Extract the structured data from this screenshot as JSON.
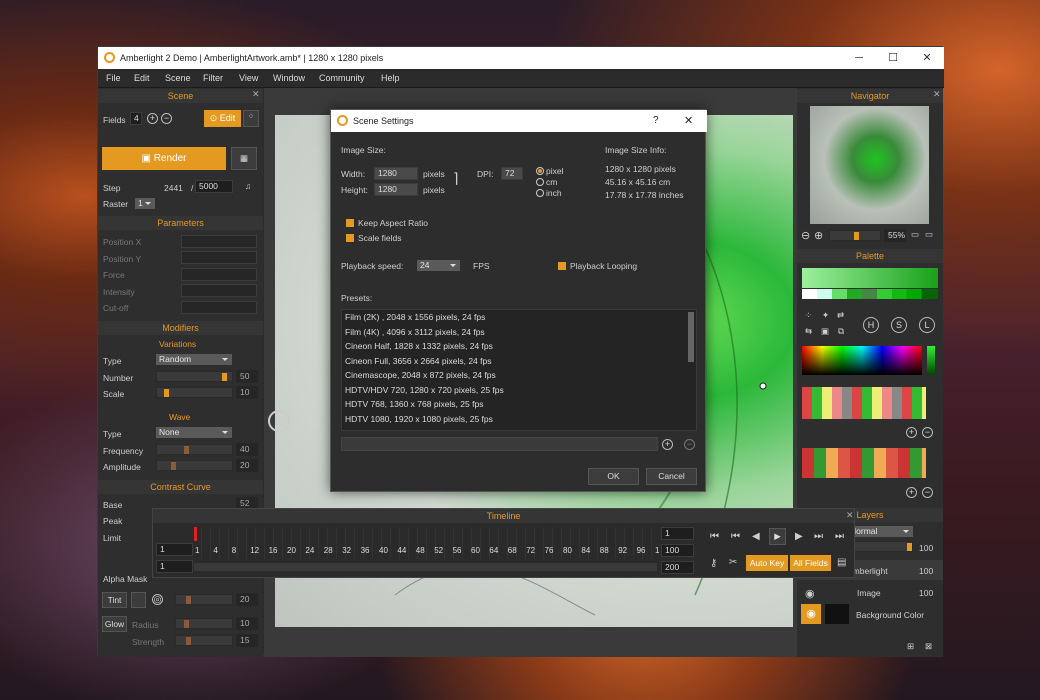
{
  "window": {
    "title": "Amberlight 2 Demo | AmberlightArtwork.amb* | 1280 x 1280 pixels"
  },
  "menu": [
    "File",
    "Edit",
    "Scene",
    "Filter",
    "View",
    "Window",
    "Community",
    "Help"
  ],
  "scene_panel": {
    "title": "Scene",
    "fields_label": "Fields",
    "fields_value": "4",
    "edit_label": "Edit",
    "render_label": "Render",
    "step_label": "Step",
    "step_value": "2441",
    "step_sep": "/",
    "step_total": "5000",
    "raster_label": "Raster",
    "raster_value": "1"
  },
  "parameters": {
    "title": "Parameters",
    "items": [
      "Position X",
      "Position Y",
      "Force",
      "Intensity",
      "Cut-off"
    ]
  },
  "modifiers": {
    "title": "Modifiers",
    "variations_title": "Variations",
    "type_label": "Type",
    "type_value": "Random",
    "number_label": "Number",
    "number_value": "50",
    "scale_label": "Scale",
    "scale_value": "10",
    "wave_title": "Wave",
    "wave_type_label": "Type",
    "wave_type_value": "None",
    "frequency_label": "Frequency",
    "frequency_value": "40",
    "amplitude_label": "Amplitude",
    "amplitude_value": "20",
    "number_level": 0.95,
    "scale_level": 0.1,
    "frequency_level": 0.4,
    "amplitude_level": 0.2
  },
  "contrast_curve": {
    "title": "Contrast Curve",
    "base_label": "Base",
    "base_value": "52",
    "peak_label": "Peak",
    "limit_label": "Limit",
    "alpha_mask_label": "Alpha Mask",
    "tint_label": "Tint",
    "tint_value": "20",
    "glow_label": "Glow",
    "radius_label": "Radius",
    "radius_value": "10",
    "strength_label": "Strength",
    "strength_value": "15"
  },
  "dialog": {
    "title": "Scene Settings",
    "help": "?",
    "close": "✕",
    "image_size_label": "Image Size:",
    "width_label": "Width:",
    "width_value": "1280",
    "height_label": "Height:",
    "height_value": "1280",
    "pixels_unit": "pixels",
    "dpi_label": "DPI:",
    "dpi_value": "72",
    "units": [
      "pixel",
      "cm",
      "inch"
    ],
    "selected_unit": "pixel",
    "info_label": "Image Size Info:",
    "info_lines": [
      "1280 x 1280 pixels",
      "45.16 x 45.16 cm",
      "17.78 x 17.78 inches"
    ],
    "keep_aspect": "Keep Aspect Ratio",
    "scale_fields": "Scale fields",
    "playback_speed_label": "Playback speed:",
    "playback_speed_value": "24",
    "fps": "FPS",
    "playback_looping": "Playback Looping",
    "presets_label": "Presets:",
    "presets": [
      "Film (2K) , 2048 x 1556 pixels, 24 fps",
      "Film (4K) , 4096 x 3112 pixels, 24 fps",
      "Cineon Half, 1828 x 1332 pixels, 24 fps",
      "Cineon Full, 3656 x 2664 pixels, 24 fps",
      "Cinemascope, 2048 x 872 pixels, 24 fps",
      "HDTV/HDV 720, 1280 x 720 pixels, 25 fps",
      "HDTV 768, 1360 x 768 pixels, 25 fps",
      "HDTV 1080, 1920 x 1080 pixels, 25 fps"
    ],
    "ok_label": "OK",
    "cancel_label": "Cancel"
  },
  "navigator": {
    "title": "Navigator",
    "zoom": "55%",
    "zoom_level": 0.55
  },
  "palette": {
    "title": "Palette",
    "buttons": [
      "H",
      "S",
      "L"
    ]
  },
  "layers": {
    "title": "Layers",
    "blend": "Normal",
    "opacity": "100",
    "items": [
      {
        "name": "Amberlight",
        "value": "100"
      },
      {
        "name": "Image",
        "value": "100"
      },
      {
        "name": "Background Color",
        "value": ""
      }
    ]
  },
  "timeline": {
    "title": "Timeline",
    "ticks": [
      "1",
      "4",
      "8",
      "12",
      "16",
      "20",
      "24",
      "28",
      "32",
      "36",
      "40",
      "44",
      "48",
      "52",
      "56",
      "60",
      "64",
      "68",
      "72",
      "76",
      "80",
      "84",
      "88",
      "92",
      "96",
      "1"
    ],
    "field_a": "1",
    "field_b": "1",
    "right_a": "1",
    "right_b": "100",
    "right_c": "200",
    "auto_key": "Auto Key",
    "all_fields": "All Fields"
  }
}
